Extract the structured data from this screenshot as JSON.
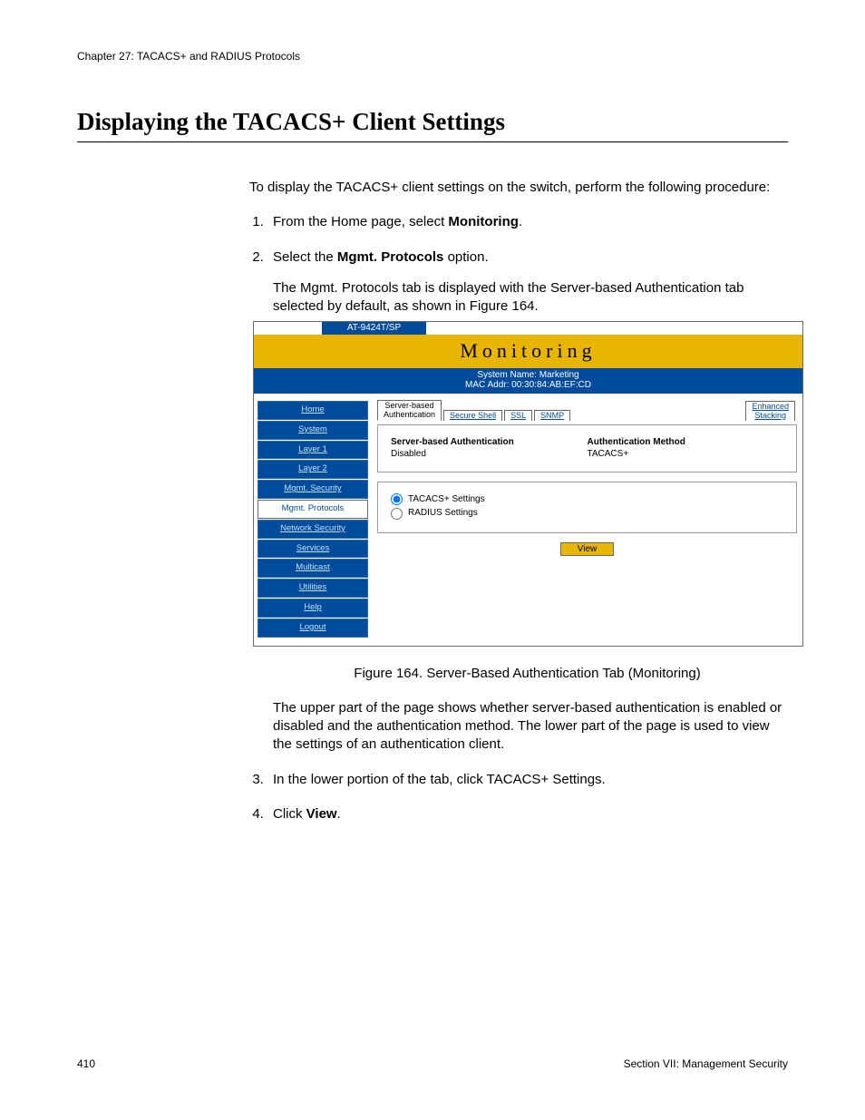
{
  "chapter_header": "Chapter 27: TACACS+ and RADIUS Protocols",
  "section_title": "Displaying the TACACS+ Client Settings",
  "intro": "To display the TACACS+ client settings on the switch, perform the following procedure:",
  "step1_pre": "From the Home page, select ",
  "step1_bold": "Monitoring",
  "step1_post": ".",
  "step2_pre": "Select the ",
  "step2_bold": "Mgmt. Protocols",
  "step2_post": " option.",
  "step2_sub": "The Mgmt. Protocols tab is displayed with the Server-based Authentication tab selected by default, as shown in Figure 164.",
  "figure": {
    "model": "AT-9424T/SP",
    "title": "Monitoring",
    "sysname": "System Name: Marketing",
    "macaddr": "MAC Addr: 00:30:84:AB:EF:CD",
    "nav": [
      "Home",
      "System",
      "Layer 1",
      "Layer 2",
      "Mgmt. Security",
      "Mgmt. Protocols",
      "Network Security",
      "Services",
      "Multicast",
      "Utilities",
      "Help",
      "Logout"
    ],
    "nav_active_index": 5,
    "tabs": {
      "t0": "Server-based\nAuthentication",
      "t1": "Secure Shell",
      "t2": "SSL",
      "t3": "SNMP",
      "t4": "Enhanced\nStacking"
    },
    "panel1": {
      "l1_label": "Server-based Authentication",
      "l1_value": "Disabled",
      "r1_label": "Authentication Method",
      "r1_value": "TACACS+"
    },
    "panel2": {
      "opt1": "TACACS+ Settings",
      "opt2": "RADIUS Settings"
    },
    "view_btn": "View"
  },
  "figure_caption": "Figure 164. Server-Based Authentication Tab (Monitoring)",
  "para_after_fig": "The upper part of the page shows whether server-based authentication is enabled or disabled and the authentication method. The lower part of the page is used to view the settings of an authentication client.",
  "step3": "In the lower portion of the tab, click TACACS+ Settings.",
  "step4_pre": "Click ",
  "step4_bold": "View",
  "step4_post": ".",
  "footer_left": "410",
  "footer_right": "Section VII: Management Security"
}
